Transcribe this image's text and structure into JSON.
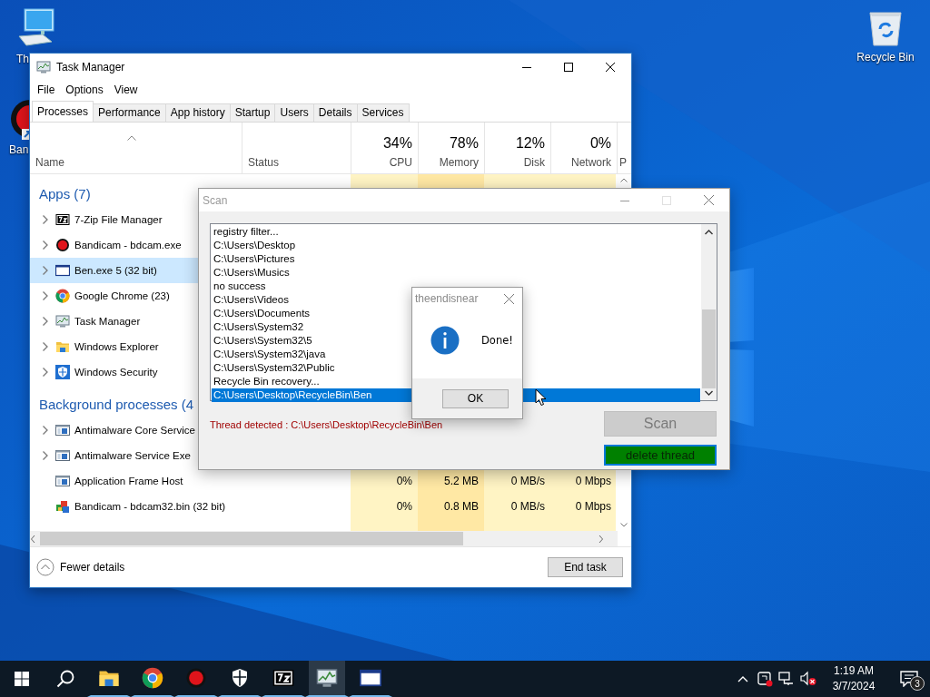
{
  "desktop": {
    "icons": [
      {
        "kind": "pc",
        "label": "Th"
      },
      {
        "kind": "recorder",
        "label": "Ban"
      },
      {
        "kind": "recycle",
        "label": "Recycle Bin"
      }
    ]
  },
  "task_manager": {
    "title": "Task Manager",
    "menu": [
      "File",
      "Options",
      "View"
    ],
    "tabs": [
      {
        "label": "Processes",
        "selected": true
      },
      {
        "label": "Performance",
        "selected": false
      },
      {
        "label": "App history",
        "selected": false
      },
      {
        "label": "Startup",
        "selected": false
      },
      {
        "label": "Users",
        "selected": false
      },
      {
        "label": "Details",
        "selected": false
      },
      {
        "label": "Services",
        "selected": false
      }
    ],
    "columns": [
      {
        "header": "Name"
      },
      {
        "header": "Status"
      },
      {
        "percent": "34%",
        "header": "CPU"
      },
      {
        "percent": "78%",
        "header": "Memory"
      },
      {
        "percent": "12%",
        "header": "Disk"
      },
      {
        "percent": "0%",
        "header": "Network"
      },
      {
        "header": "P"
      }
    ],
    "groups": [
      {
        "heading": "Apps (7)",
        "rows": [
          {
            "name": "7-Zip File Manager",
            "kind": "archive",
            "expandable": true,
            "selected": false
          },
          {
            "name": "Bandicam - bdcam.exe",
            "kind": "recorder",
            "expandable": true,
            "selected": false
          },
          {
            "name": "Ben.exe 5 (32 bit)",
            "kind": "window",
            "expandable": true,
            "selected": true
          },
          {
            "name": "Google Chrome (23)",
            "kind": "browser",
            "expandable": true,
            "selected": false
          },
          {
            "name": "Task Manager",
            "kind": "monitor",
            "expandable": true,
            "selected": false
          },
          {
            "name": "Windows Explorer",
            "kind": "folder",
            "expandable": true,
            "selected": false
          },
          {
            "name": "Windows Security",
            "kind": "shield",
            "expandable": true,
            "selected": false
          }
        ]
      },
      {
        "heading": "Background processes (4",
        "rows": [
          {
            "name": "Antimalware Core Service",
            "kind": "service",
            "expandable": true,
            "selected": false
          },
          {
            "name": "Antimalware Service Exe",
            "kind": "service",
            "expandable": true,
            "selected": false
          },
          {
            "name": "Application Frame Host",
            "kind": "service",
            "expandable": false,
            "selected": false,
            "values": [
              "0%",
              "5.2 MB",
              "0 MB/s",
              "0 Mbps"
            ]
          },
          {
            "name": "Bandicam - bdcam32.bin (32 bit)",
            "kind": "blocks",
            "expandable": false,
            "selected": false,
            "values": [
              "0%",
              "0.8 MB",
              "0 MB/s",
              "0 Mbps"
            ]
          }
        ]
      }
    ],
    "fewer_details": "Fewer details",
    "end_task": "End task"
  },
  "scan_window": {
    "title": "Scan",
    "log": [
      {
        "text": "registry filter...",
        "selected": false
      },
      {
        "text": "C:\\Users\\Desktop",
        "selected": false
      },
      {
        "text": "C:\\Users\\Pictures",
        "selected": false
      },
      {
        "text": "C:\\Users\\Musics",
        "selected": false
      },
      {
        "text": "no success",
        "selected": false
      },
      {
        "text": "C:\\Users\\Videos",
        "selected": false
      },
      {
        "text": "C:\\Users\\Documents",
        "selected": false
      },
      {
        "text": "C:\\Users\\System32",
        "selected": false
      },
      {
        "text": "C:\\Users\\System32\\5",
        "selected": false
      },
      {
        "text": "C:\\Users\\System32\\java",
        "selected": false
      },
      {
        "text": "C:\\Users\\System32\\Public",
        "selected": false
      },
      {
        "text": "Recycle Bin recovery...",
        "selected": false
      },
      {
        "text": "C:\\Users\\Desktop\\RecycleBin\\Ben",
        "selected": true
      }
    ],
    "status": "Thread detected : C:\\Users\\Desktop\\RecycleBin\\Ben",
    "buttons": [
      {
        "label": "Scan",
        "kind": "plain",
        "disabled": true
      },
      {
        "label": "delete thread",
        "kind": "green",
        "disabled": false
      }
    ]
  },
  "message_box": {
    "title": "theendisnear",
    "message": "Done!",
    "button": "OK"
  },
  "taskbar": {
    "apps": [
      {
        "kind": "folder",
        "running": true,
        "active": false
      },
      {
        "kind": "browser",
        "running": true,
        "active": false
      },
      {
        "kind": "recorder",
        "running": true,
        "active": false
      },
      {
        "kind": "shield",
        "running": true,
        "active": false
      },
      {
        "kind": "archive",
        "running": true,
        "active": false
      },
      {
        "kind": "monitor",
        "running": true,
        "active": true
      },
      {
        "kind": "window",
        "running": true,
        "active": false
      }
    ],
    "time": "1:19 AM",
    "date": "3/7/2024",
    "notifications": "3"
  }
}
